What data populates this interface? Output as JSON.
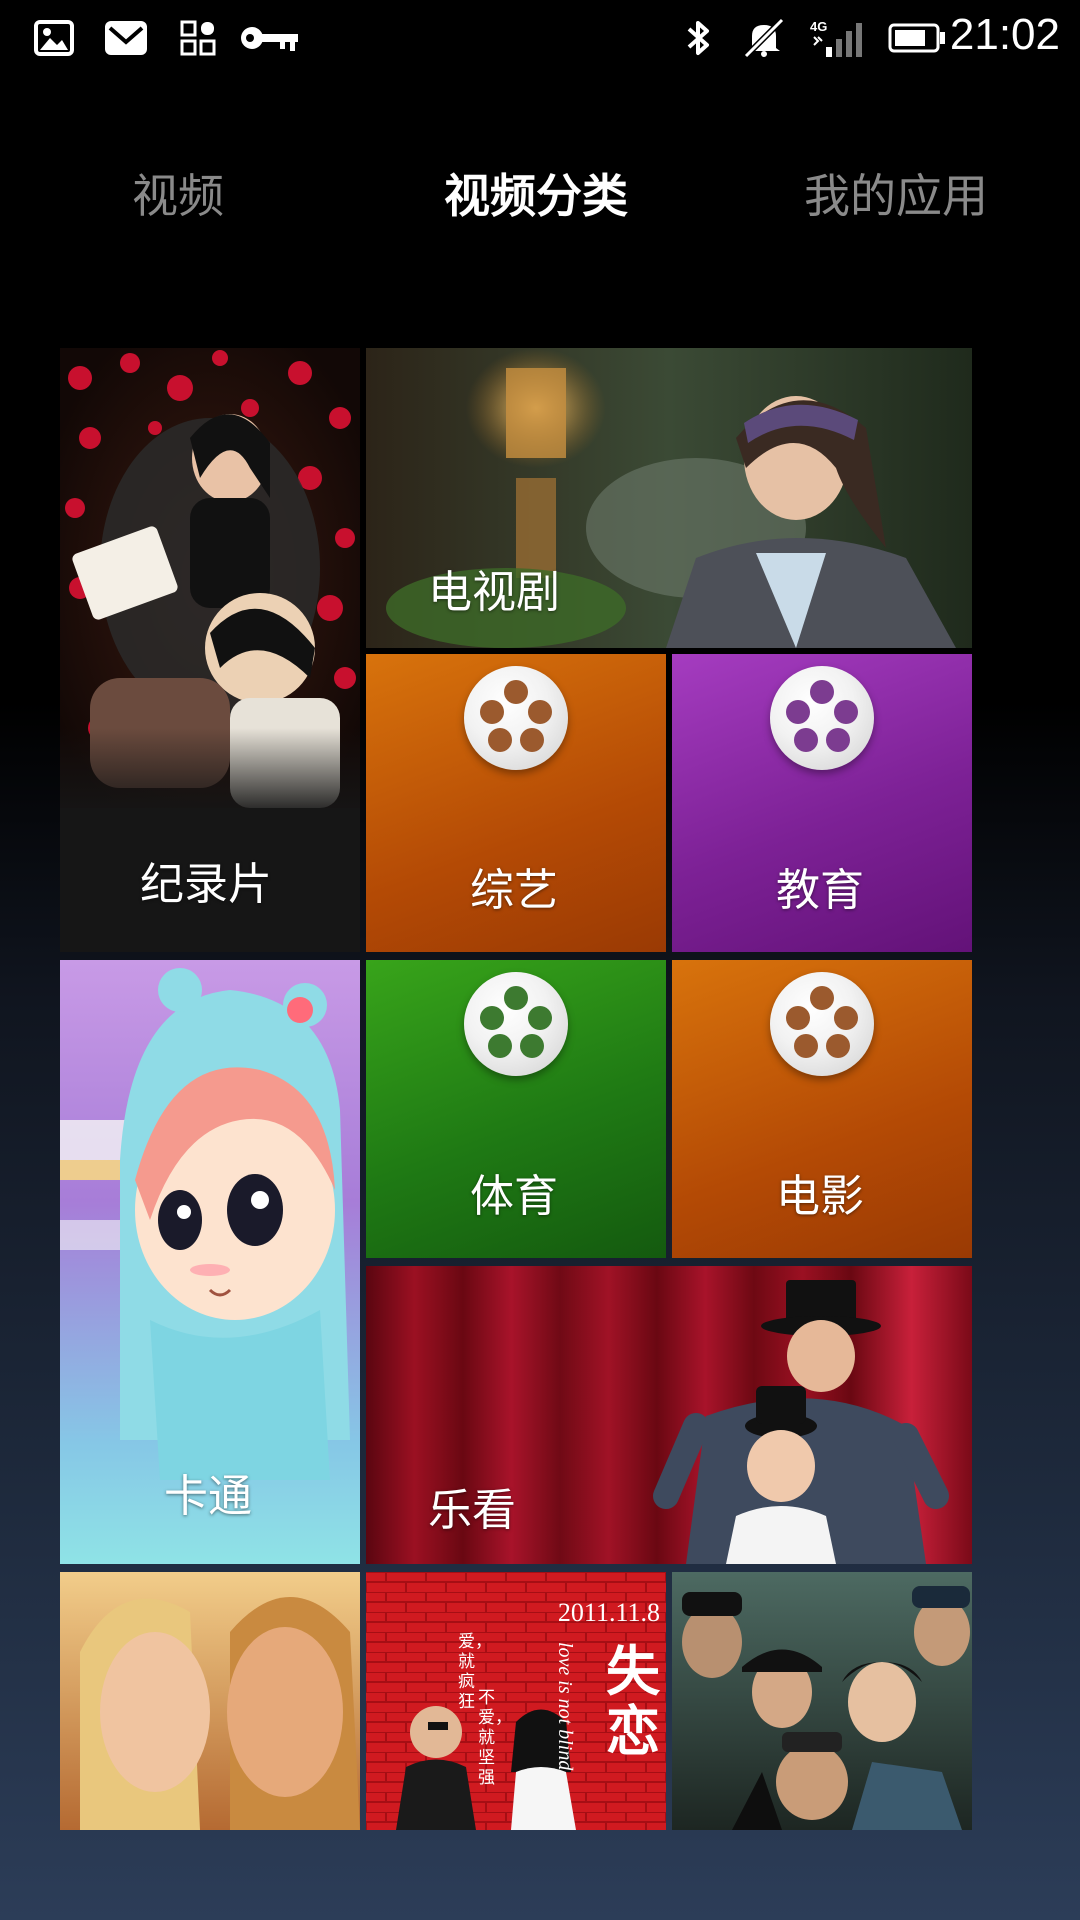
{
  "status_bar": {
    "time": "21:02",
    "left_icons": [
      "image-icon",
      "mail-icon",
      "apps-grid-icon",
      "key-icon"
    ],
    "right_icons": [
      "bluetooth-icon",
      "mute-icon",
      "signal-4g-icon",
      "battery-icon"
    ],
    "network_label": "4G"
  },
  "tabs": [
    {
      "label": "视频",
      "active": false
    },
    {
      "label": "视频分类",
      "active": true
    },
    {
      "label": "我的应用",
      "active": false
    }
  ],
  "tiles": {
    "documentary": {
      "label": "纪录片"
    },
    "tv_series": {
      "label": "电视剧"
    },
    "variety": {
      "label": "综艺",
      "color": "#c45a08"
    },
    "education": {
      "label": "教育",
      "color": "#7e2596"
    },
    "cartoon": {
      "label": "卡通"
    },
    "sports": {
      "label": "体育",
      "color": "#1f6e12"
    },
    "movie": {
      "label": "电影",
      "color": "#c45a08"
    },
    "lekan": {
      "label": "乐看"
    }
  },
  "posters": {
    "shilian": {
      "date": "2011.11.8",
      "title": "失恋",
      "tagline_1": "爱，就疯狂",
      "tagline_2": "不爱，就坚强",
      "english": "love is not blind"
    }
  }
}
